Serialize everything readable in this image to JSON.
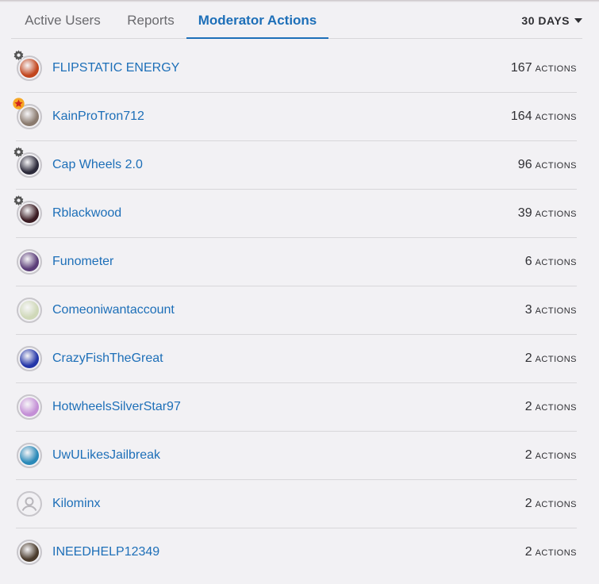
{
  "tabs": [
    {
      "label": "Active Users"
    },
    {
      "label": "Reports"
    },
    {
      "label": "Moderator Actions"
    }
  ],
  "range": {
    "label": "30 DAYS"
  },
  "unit_label": "ACTIONS",
  "users": [
    {
      "name": "FLIPSTATIC ENERGY",
      "count": "167",
      "badge": "gear-icon",
      "avatar_color": "#c2461e"
    },
    {
      "name": "KainProTron712",
      "count": "164",
      "badge": "star-icon",
      "avatar_color": "#8a7a6e"
    },
    {
      "name": "Cap Wheels 2.0",
      "count": "96",
      "badge": "gear-icon",
      "avatar_color": "#2c2a3a"
    },
    {
      "name": "Rblackwood",
      "count": "39",
      "badge": "gear-icon",
      "avatar_color": "#3a1b22"
    },
    {
      "name": "Funometer",
      "count": "6",
      "badge": "",
      "avatar_color": "#5b3d78"
    },
    {
      "name": "Comeoniwantaccount",
      "count": "3",
      "badge": "",
      "avatar_color": "#cfd8b8"
    },
    {
      "name": "CrazyFishTheGreat",
      "count": "2",
      "badge": "",
      "avatar_color": "#2436a8"
    },
    {
      "name": "HotwheelsSilverStar97",
      "count": "2",
      "badge": "",
      "avatar_color": "#c48fd6"
    },
    {
      "name": "UwULikesJailbreak",
      "count": "2",
      "badge": "",
      "avatar_color": "#2a89b8"
    },
    {
      "name": "Kilominx",
      "count": "2",
      "badge": "",
      "avatar_color": ""
    },
    {
      "name": "INEEDHELP12349",
      "count": "2",
      "badge": "",
      "avatar_color": "#4a3b2c"
    }
  ]
}
